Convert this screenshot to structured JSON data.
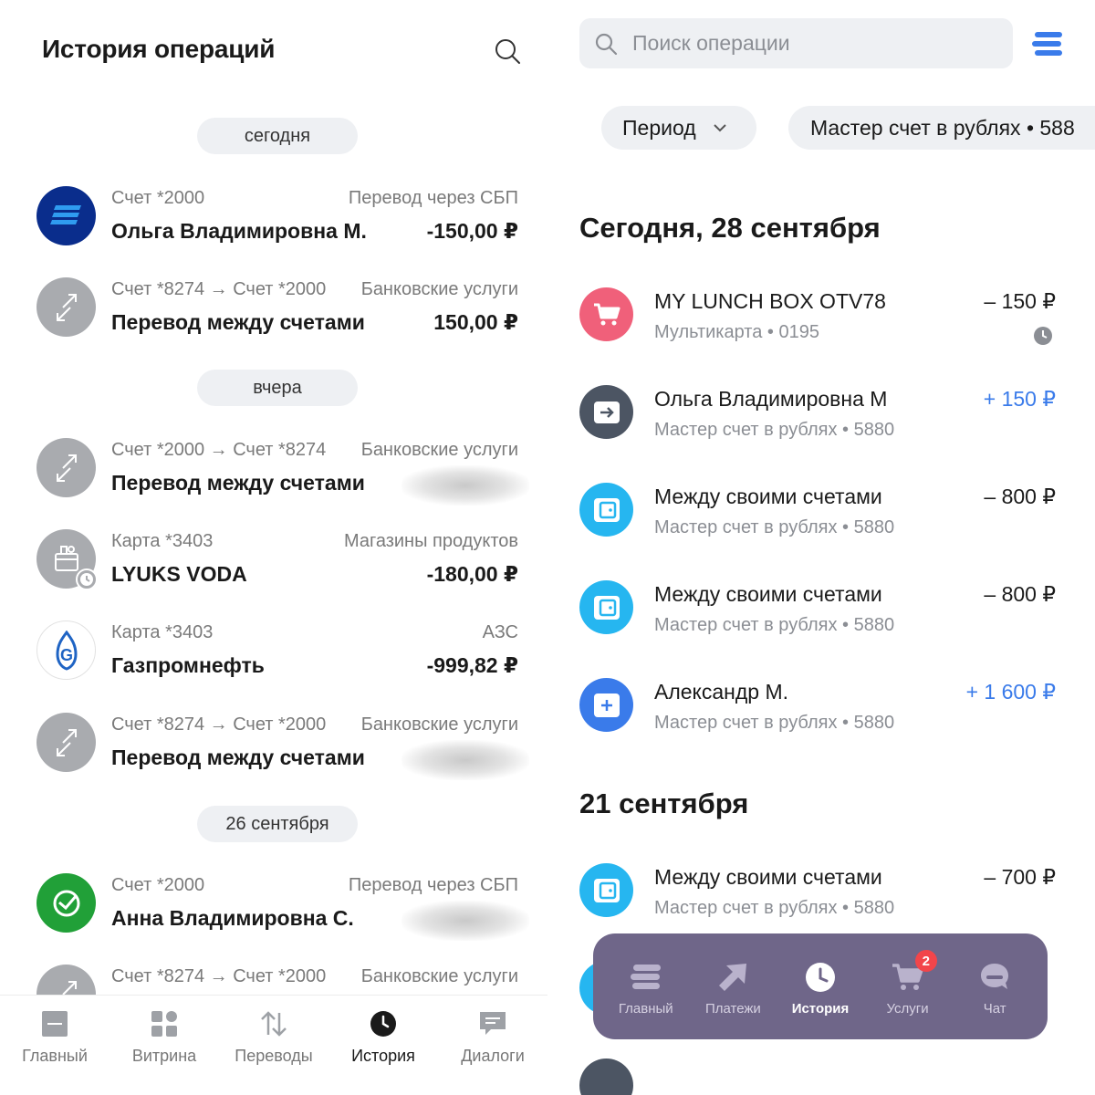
{
  "left": {
    "title": "История операций",
    "groups": [
      {
        "label": "сегодня",
        "items": [
          {
            "account": "Счет *2000",
            "category": "Перевод через СБП",
            "name": "Ольга Владимировна М.",
            "amount": "-150,00 ₽",
            "icon": "sbp-logo-icon"
          },
          {
            "account": "Счет *8274 → Счет *2000",
            "category": "Банковские услуги",
            "name": "Перевод между счетами",
            "amount": "150,00 ₽",
            "icon": "transfer-arrows-icon"
          }
        ]
      },
      {
        "label": "вчера",
        "items": [
          {
            "account": "Счет *2000 → Счет *8274",
            "category": "Банковские услуги",
            "name": "Перевод между счетами",
            "amount": "",
            "icon": "transfer-arrows-icon"
          },
          {
            "account": "Карта *3403",
            "category": "Магазины продуктов",
            "name": "LYUKS VODA",
            "amount": "-180,00 ₽",
            "icon": "grocery-basket-icon"
          },
          {
            "account": "Карта *3403",
            "category": "АЗС",
            "name": "Газпромнефть",
            "amount": "-999,82 ₽",
            "icon": "gazprom-logo-icon"
          },
          {
            "account": "Счет *8274 → Счет *2000",
            "category": "Банковские услуги",
            "name": "Перевод между счетами",
            "amount": "",
            "icon": "transfer-arrows-icon"
          }
        ]
      },
      {
        "label": "26 сентября",
        "items": [
          {
            "account": "Счет *2000",
            "category": "Перевод через СБП",
            "name": "Анна Владимировна С.",
            "amount": "",
            "icon": "sberbank-logo-icon"
          },
          {
            "account": "Счет *8274 → Счет *2000",
            "category": "Банковские услуги",
            "name": "",
            "amount": "",
            "icon": "transfer-arrows-icon"
          }
        ]
      }
    ],
    "nav": [
      {
        "label": "Главный",
        "icon": "home-square-icon"
      },
      {
        "label": "Витрина",
        "icon": "grid-icon"
      },
      {
        "label": "Переводы",
        "icon": "up-down-arrows-icon"
      },
      {
        "label": "История",
        "icon": "clock-icon",
        "active": true
      },
      {
        "label": "Диалоги",
        "icon": "chat-bubble-icon"
      }
    ]
  },
  "right": {
    "search_placeholder": "Поиск операции",
    "filters": {
      "period": "Период",
      "account": "Мастер счет в рублях • 588"
    },
    "sections": [
      {
        "date": "Сегодня, 28 сентября",
        "items": [
          {
            "name": "MY LUNCH BOX OTV78",
            "sub": "Мультикарта • 0195",
            "amount": "– 150 ₽",
            "positive": false,
            "pending": true,
            "icon": "shopping-cart-icon",
            "color": "#f0607a"
          },
          {
            "name": "Ольга Владимировна М",
            "sub": "Мастер счет в рублях • 5880",
            "amount": "+ 150 ₽",
            "positive": true,
            "icon": "incoming-transfer-icon",
            "color": "#4c5563"
          },
          {
            "name": "Между своими счетами",
            "sub": "Мастер счет в рублях • 5880",
            "amount": "– 800 ₽",
            "positive": false,
            "icon": "wallet-icon",
            "color": "#26b6f0"
          },
          {
            "name": "Между своими счетами",
            "sub": "Мастер счет в рублях • 5880",
            "amount": "– 800 ₽",
            "positive": false,
            "icon": "wallet-icon",
            "color": "#26b6f0"
          },
          {
            "name": "Александр М.",
            "sub": "Мастер счет в рублях • 5880",
            "amount": "+ 1 600 ₽",
            "positive": true,
            "icon": "add-wallet-icon",
            "color": "#3a7bea"
          }
        ]
      },
      {
        "date": "21 сентября",
        "items": [
          {
            "name": "Между своими счетами",
            "sub": "Мастер счет в рублях • 5880",
            "amount": "– 700 ₽",
            "positive": false,
            "icon": "wallet-icon",
            "color": "#26b6f0"
          }
        ]
      }
    ],
    "tabbar": [
      {
        "label": "Главный",
        "icon": "stack-icon"
      },
      {
        "label": "Платежи",
        "icon": "arrow-up-right-icon"
      },
      {
        "label": "История",
        "icon": "clock-icon",
        "active": true
      },
      {
        "label": "Услуги",
        "icon": "cart-icon",
        "badge": "2"
      },
      {
        "label": "Чат",
        "icon": "chat-icon"
      }
    ]
  },
  "colors": {
    "accent_blue": "#3a7bea",
    "tabbar_bg": "#6f6689",
    "chip_bg": "#eef0f3",
    "badge_red": "#f2454a"
  }
}
